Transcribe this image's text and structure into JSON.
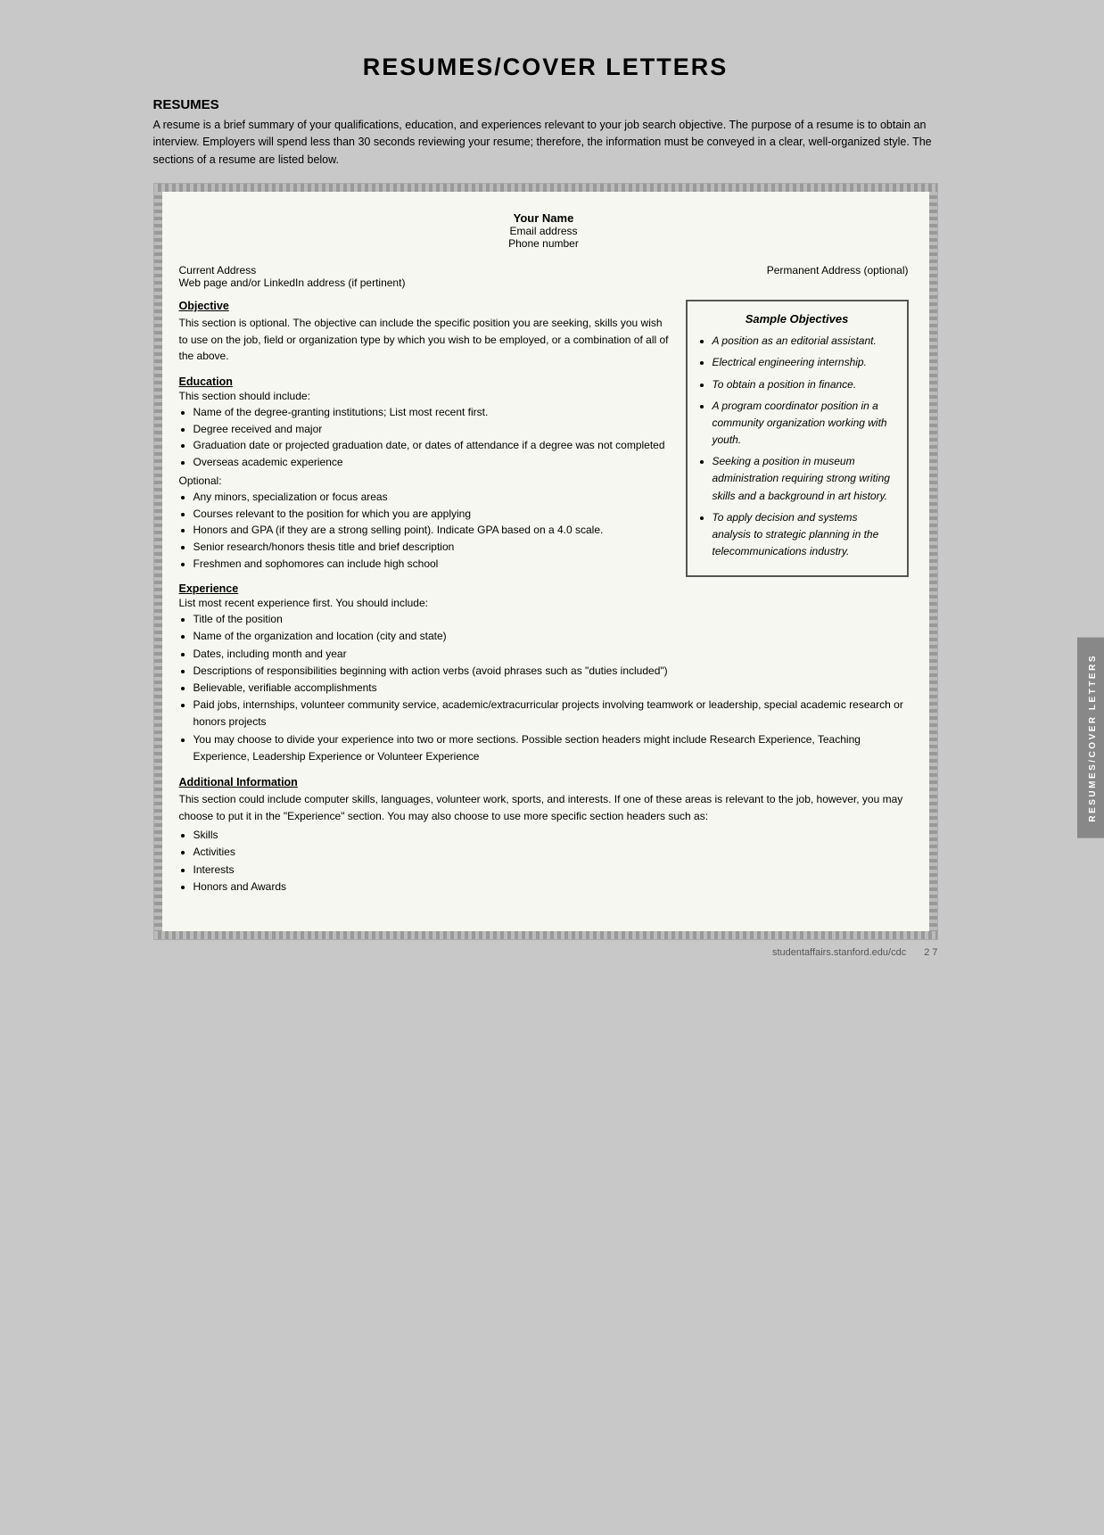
{
  "page": {
    "title": "RESUMES/COVER LETTERS",
    "footer_url": "studentaffairs.stanford.edu/cdc",
    "footer_page": "2 7"
  },
  "resumes_section": {
    "heading": "RESUMES",
    "intro": "A resume is a brief summary of your qualifications, education, and experiences relevant to your job search objective. The purpose of a resume is to obtain an interview. Employers will spend less than 30 seconds reviewing your resume; therefore, the information must be conveyed in a clear, well-organized style. The sections of a resume are listed below."
  },
  "resume_template": {
    "name": "Your Name",
    "email": "Email address",
    "phone": "Phone number",
    "current_address": "Current Address",
    "web_linkedin": "Web page and/or LinkedIn address (if pertinent)",
    "permanent_address": "Permanent Address (optional)"
  },
  "objective_section": {
    "title": "Objective",
    "text": "This section is optional. The objective can include the specific position you are seeking, skills you wish to use on the job, field or organization type by which you wish to be employed, or a combination of all of the above."
  },
  "education_section": {
    "title": "Education",
    "intro": "This section should include:",
    "required_items": [
      "Name of the degree-granting institutions; List most recent first.",
      "Degree received and major",
      "Graduation date or projected graduation date, or dates of attendance if a degree was not completed",
      "Overseas academic experience"
    ],
    "optional_label": "Optional:",
    "optional_items": [
      "Any minors, specialization or focus areas",
      "Courses relevant to the position for which you are applying",
      "Honors and GPA (if they are a strong selling point). Indicate GPA based on a 4.0 scale.",
      "Senior research/honors thesis title and brief description",
      "Freshmen and sophomores can include high school"
    ]
  },
  "experience_section": {
    "title": "Experience",
    "intro": "List most recent experience first. You should include:",
    "items": [
      "Title of the position",
      "Name of the organization and location (city and state)",
      "Dates, including month and year",
      "Descriptions of responsibilities beginning with action verbs (avoid phrases such as \"duties included\")",
      "Believable, verifiable accomplishments",
      "Paid jobs, internships, volunteer community service, academic/extracurricular projects involving teamwork or leadership, special academic research or honors projects",
      "You may choose to divide your experience into two or more sections. Possible section headers might include Research Experience, Teaching Experience, Leadership Experience or Volunteer Experience"
    ]
  },
  "additional_info_section": {
    "title": "Additional Information",
    "text": "This section could include computer skills, languages, volunteer work, sports, and interests. If one of these areas is relevant to the job, however, you may choose to put it in the \"Experience\" section. You may also choose to use more specific section headers such as:",
    "items": [
      "Skills",
      "Activities",
      "Interests",
      "Honors and Awards"
    ]
  },
  "sample_objectives": {
    "title": "Sample Objectives",
    "items": [
      "A position as an editorial assistant.",
      "Electrical engineering internship.",
      "To obtain a position in finance.",
      "A program coordinator position in a community organization working with youth.",
      "Seeking a position in museum administration requiring strong writing skills and a background in art history.",
      "To apply decision and systems analysis to strategic planning in the telecommunications industry."
    ]
  },
  "side_tab": {
    "label": "RESUMES/COVER LETTERS"
  }
}
